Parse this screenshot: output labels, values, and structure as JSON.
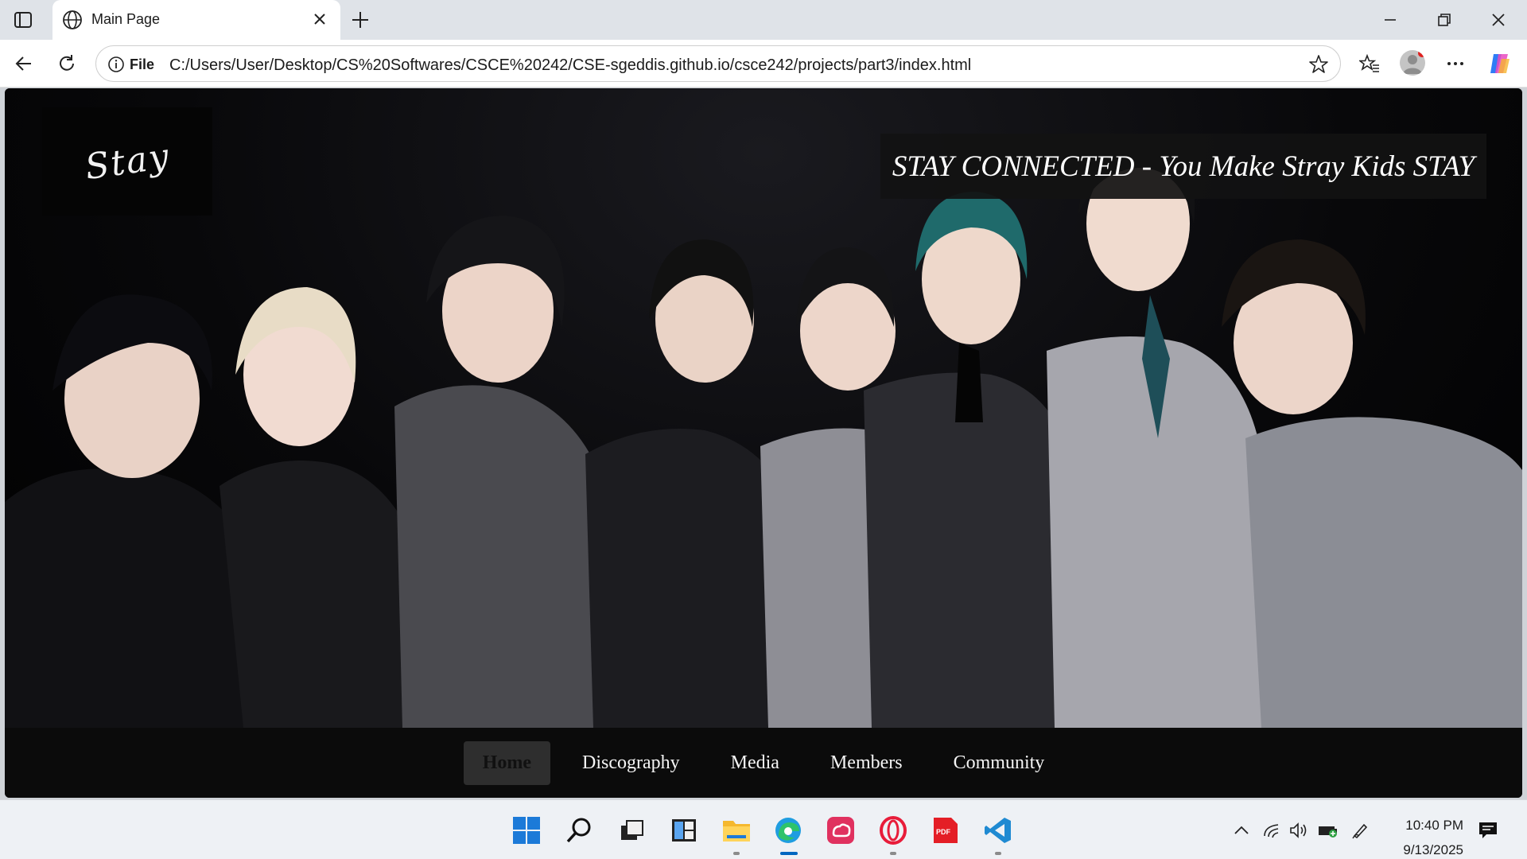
{
  "browser": {
    "tab_title": "Main Page",
    "address_scheme": "File",
    "address_url": "C:/Users/User/Desktop/CS%20Softwares/CSCE%20242/CSE-sgeddis.github.io/csce242/projects/part3/index.html"
  },
  "page": {
    "logo_text": "Stay",
    "tagline": "STAY CONNECTED - You Make Stray Kids STAY",
    "hero_image": "group-photo",
    "nav": [
      {
        "label": "Home",
        "active": true
      },
      {
        "label": "Discography",
        "active": false
      },
      {
        "label": "Media",
        "active": false
      },
      {
        "label": "Members",
        "active": false
      },
      {
        "label": "Community",
        "active": false
      }
    ]
  },
  "taskbar": {
    "apps": [
      "start-icon",
      "search-icon",
      "task-view-icon",
      "widgets-icon",
      "file-explorer-icon",
      "edge-icon",
      "creative-cloud-icon",
      "opera-icon",
      "pdf-icon",
      "vscode-icon"
    ],
    "time": "10:40 PM",
    "date": "9/13/2025"
  },
  "colors": {
    "accent": "#0067c0",
    "page_bg": "#000000",
    "nav_active_bg": "#2e2e2e"
  }
}
